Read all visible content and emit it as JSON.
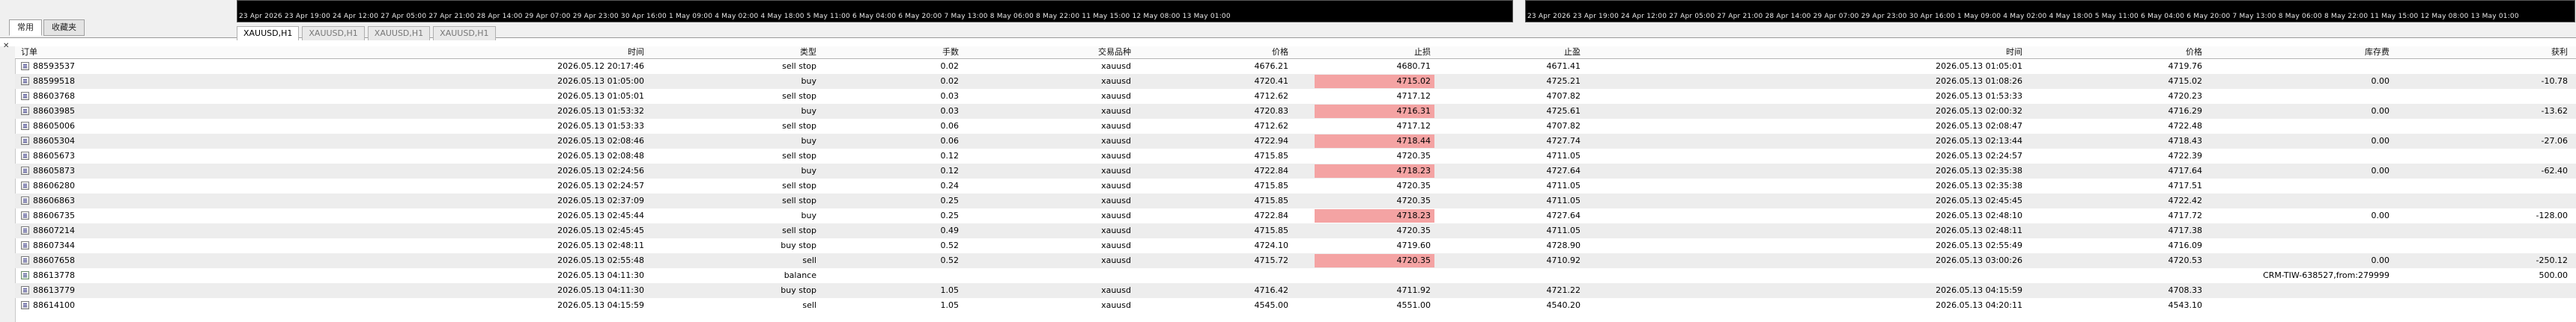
{
  "nav_tabs": [
    "常用",
    "收藏夹"
  ],
  "chart_strip_1": "23 Apr 2026   23 Apr 19:00   24 Apr 12:00   27 Apr 05:00   27 Apr 21:00   28 Apr 14:00   29 Apr 07:00   29 Apr 23:00   30 Apr 16:00   1 May 09:00   4 May 02:00   4 May 18:00   5 May 11:00   6 May 04:00   6 May 20:00   7 May 13:00   8 May 06:00   8 May 22:00   11 May 15:00   12 May 08:00   13 May 01:00",
  "chart_strip_2": "23 Apr 2026   23 Apr 19:00   24 Apr 12:00   27 Apr 05:00   27 Apr 21:00   28 Apr 14:00   29 Apr 07:00   29 Apr 23:00   30 Apr 16:00   1 May 09:00   4 May 02:00   4 May 18:00   5 May 11:00   6 May 04:00   6 May 20:00   7 May 13:00   8 May 06:00   8 May 22:00   11 May 15:00   12 May 08:00   13 May 01:00",
  "chart_tabs": [
    "XAUUSD,H1",
    "XAUUSD,H1",
    "XAUUSD,H1",
    "XAUUSD,H1"
  ],
  "columns": {
    "order": "订单",
    "open_time": "时间",
    "type": "类型",
    "volume": "手数",
    "symbol": "交易品种",
    "price": "价格",
    "sl": "止损",
    "tp": "止盈",
    "close_time": "时间",
    "close_price": "价格",
    "swap": "库存费",
    "profit": "获利"
  },
  "rows": [
    {
      "order": "88593537",
      "open_time": "2026.05.12 20:17:46",
      "type": "sell stop",
      "volume": "0.02",
      "symbol": "xauusd",
      "price": "4676.21",
      "sl": "4680.71",
      "tp": "4671.41",
      "close_time": "2026.05.13 01:05:01",
      "close_price": "4719.76",
      "swap": "",
      "profit": "",
      "sl_hit": false,
      "kind": "order"
    },
    {
      "order": "88599518",
      "open_time": "2026.05.13 01:05:00",
      "type": "buy",
      "volume": "0.02",
      "symbol": "xauusd",
      "price": "4720.41",
      "sl": "4715.02",
      "tp": "4725.21",
      "close_time": "2026.05.13 01:08:26",
      "close_price": "4715.02",
      "swap": "0.00",
      "profit": "-10.78",
      "sl_hit": true,
      "kind": "order"
    },
    {
      "order": "88603768",
      "open_time": "2026.05.13 01:05:01",
      "type": "sell stop",
      "volume": "0.03",
      "symbol": "xauusd",
      "price": "4712.62",
      "sl": "4717.12",
      "tp": "4707.82",
      "close_time": "2026.05.13 01:53:33",
      "close_price": "4720.23",
      "swap": "",
      "profit": "",
      "sl_hit": false,
      "kind": "order"
    },
    {
      "order": "88603985",
      "open_time": "2026.05.13 01:53:32",
      "type": "buy",
      "volume": "0.03",
      "symbol": "xauusd",
      "price": "4720.83",
      "sl": "4716.31",
      "tp": "4725.61",
      "close_time": "2026.05.13 02:00:32",
      "close_price": "4716.29",
      "swap": "0.00",
      "profit": "-13.62",
      "sl_hit": true,
      "kind": "order"
    },
    {
      "order": "88605006",
      "open_time": "2026.05.13 01:53:33",
      "type": "sell stop",
      "volume": "0.06",
      "symbol": "xauusd",
      "price": "4712.62",
      "sl": "4717.12",
      "tp": "4707.82",
      "close_time": "2026.05.13 02:08:47",
      "close_price": "4722.48",
      "swap": "",
      "profit": "",
      "sl_hit": false,
      "kind": "order"
    },
    {
      "order": "88605304",
      "open_time": "2026.05.13 02:08:46",
      "type": "buy",
      "volume": "0.06",
      "symbol": "xauusd",
      "price": "4722.94",
      "sl": "4718.44",
      "tp": "4727.74",
      "close_time": "2026.05.13 02:13:44",
      "close_price": "4718.43",
      "swap": "0.00",
      "profit": "-27.06",
      "sl_hit": true,
      "kind": "order"
    },
    {
      "order": "88605673",
      "open_time": "2026.05.13 02:08:48",
      "type": "sell stop",
      "volume": "0.12",
      "symbol": "xauusd",
      "price": "4715.85",
      "sl": "4720.35",
      "tp": "4711.05",
      "close_time": "2026.05.13 02:24:57",
      "close_price": "4722.39",
      "swap": "",
      "profit": "",
      "sl_hit": false,
      "kind": "order"
    },
    {
      "order": "88605873",
      "open_time": "2026.05.13 02:24:56",
      "type": "buy",
      "volume": "0.12",
      "symbol": "xauusd",
      "price": "4722.84",
      "sl": "4718.23",
      "tp": "4727.64",
      "close_time": "2026.05.13 02:35:38",
      "close_price": "4717.64",
      "swap": "0.00",
      "profit": "-62.40",
      "sl_hit": true,
      "kind": "order"
    },
    {
      "order": "88606280",
      "open_time": "2026.05.13 02:24:57",
      "type": "sell stop",
      "volume": "0.24",
      "symbol": "xauusd",
      "price": "4715.85",
      "sl": "4720.35",
      "tp": "4711.05",
      "close_time": "2026.05.13 02:35:38",
      "close_price": "4717.51",
      "swap": "",
      "profit": "",
      "sl_hit": false,
      "kind": "order"
    },
    {
      "order": "88606863",
      "open_time": "2026.05.13 02:37:09",
      "type": "sell stop",
      "volume": "0.25",
      "symbol": "xauusd",
      "price": "4715.85",
      "sl": "4720.35",
      "tp": "4711.05",
      "close_time": "2026.05.13 02:45:45",
      "close_price": "4722.42",
      "swap": "",
      "profit": "",
      "sl_hit": false,
      "kind": "order"
    },
    {
      "order": "88606735",
      "open_time": "2026.05.13 02:45:44",
      "type": "buy",
      "volume": "0.25",
      "symbol": "xauusd",
      "price": "4722.84",
      "sl": "4718.23",
      "tp": "4727.64",
      "close_time": "2026.05.13 02:48:10",
      "close_price": "4717.72",
      "swap": "0.00",
      "profit": "-128.00",
      "sl_hit": true,
      "kind": "order"
    },
    {
      "order": "88607214",
      "open_time": "2026.05.13 02:45:45",
      "type": "sell stop",
      "volume": "0.49",
      "symbol": "xauusd",
      "price": "4715.85",
      "sl": "4720.35",
      "tp": "4711.05",
      "close_time": "2026.05.13 02:48:11",
      "close_price": "4717.38",
      "swap": "",
      "profit": "",
      "sl_hit": false,
      "kind": "order"
    },
    {
      "order": "88607344",
      "open_time": "2026.05.13 02:48:11",
      "type": "buy stop",
      "volume": "0.52",
      "symbol": "xauusd",
      "price": "4724.10",
      "sl": "4719.60",
      "tp": "4728.90",
      "close_time": "2026.05.13 02:55:49",
      "close_price": "4716.09",
      "swap": "",
      "profit": "",
      "sl_hit": false,
      "kind": "order"
    },
    {
      "order": "88607658",
      "open_time": "2026.05.13 02:55:48",
      "type": "sell",
      "volume": "0.52",
      "symbol": "xauusd",
      "price": "4715.72",
      "sl": "4720.35",
      "tp": "4710.92",
      "close_time": "2026.05.13 03:00:26",
      "close_price": "4720.53",
      "swap": "0.00",
      "profit": "-250.12",
      "sl_hit": true,
      "kind": "order"
    },
    {
      "order": "88613778",
      "open_time": "2026.05.13 04:11:30",
      "type": "balance",
      "volume": "",
      "symbol": "",
      "price": "",
      "sl": "",
      "tp": "",
      "close_time": "",
      "close_price": "",
      "swap": "CRM-TIW-638527,from:279999",
      "profit": "500.00",
      "sl_hit": false,
      "kind": "balance"
    },
    {
      "order": "88613779",
      "open_time": "2026.05.13 04:11:30",
      "type": "buy stop",
      "volume": "1.05",
      "symbol": "xauusd",
      "price": "4716.42",
      "sl": "4711.92",
      "tp": "4721.22",
      "close_time": "2026.05.13 04:15:59",
      "close_price": "4708.33",
      "swap": "",
      "profit": "",
      "sl_hit": false,
      "kind": "order"
    },
    {
      "order": "88614100",
      "open_time": "2026.05.13 04:15:59",
      "type": "sell",
      "volume": "1.05",
      "symbol": "xauusd",
      "price": "4545.00",
      "sl": "4551.00",
      "tp": "4540.20",
      "close_time": "2026.05.13 04:20:11",
      "close_price": "4543.10",
      "swap": "",
      "profit": "",
      "sl_hit": false,
      "kind": "order"
    }
  ]
}
